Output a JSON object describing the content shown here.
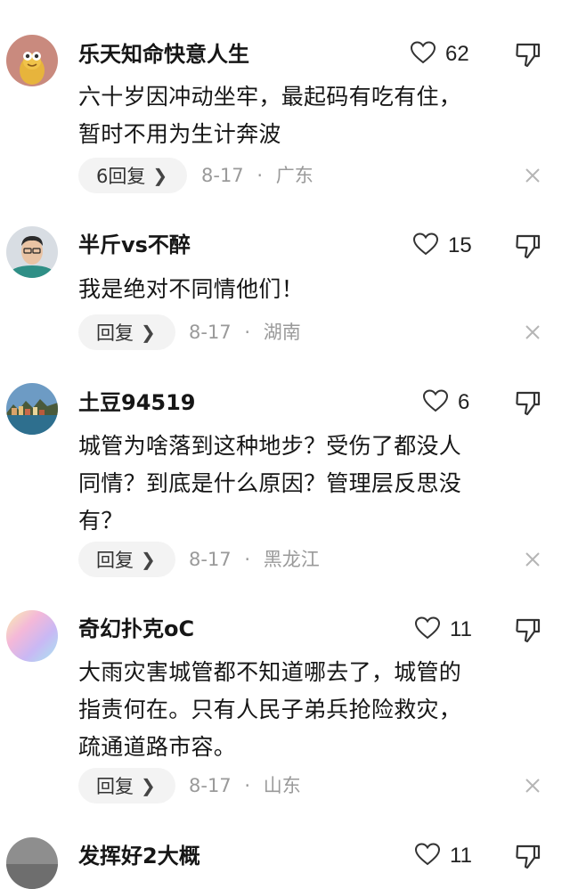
{
  "comments": [
    {
      "username": "乐天知命快意人生",
      "likes": "62",
      "text": "六十岁因冲动坐牢，最起码有吃有住，\n暂时不用为生计奔波",
      "reply_label": "6回复",
      "date": "8-17",
      "location": "广东"
    },
    {
      "username": "半斤vs不醉",
      "likes": "15",
      "text": "我是绝对不同情他们！",
      "reply_label": "回复",
      "date": "8-17",
      "location": "湖南"
    },
    {
      "username": "土豆94519",
      "likes": "6",
      "text": "城管为啥落到这种地步？受伤了都没人\n同情？到底是什么原因？管理层反思没\n有？",
      "reply_label": "回复",
      "date": "8-17",
      "location": "黑龙江"
    },
    {
      "username": "奇幻扑克oC",
      "likes": "11",
      "text": "大雨灾害城管都不知道哪去了，城管的\n指责何在。只有人民子弟兵抢险救灾，\n疏通道路市容。",
      "reply_label": "回复",
      "date": "8-17",
      "location": "山东"
    },
    {
      "username": "发挥好2大概",
      "likes": "11"
    }
  ],
  "separator": "·",
  "icons": {
    "like": "heart-outline-icon",
    "dislike": "thumbs-down-icon",
    "dismiss": "close-icon",
    "reply_chevron": "chevron-right-icon"
  }
}
